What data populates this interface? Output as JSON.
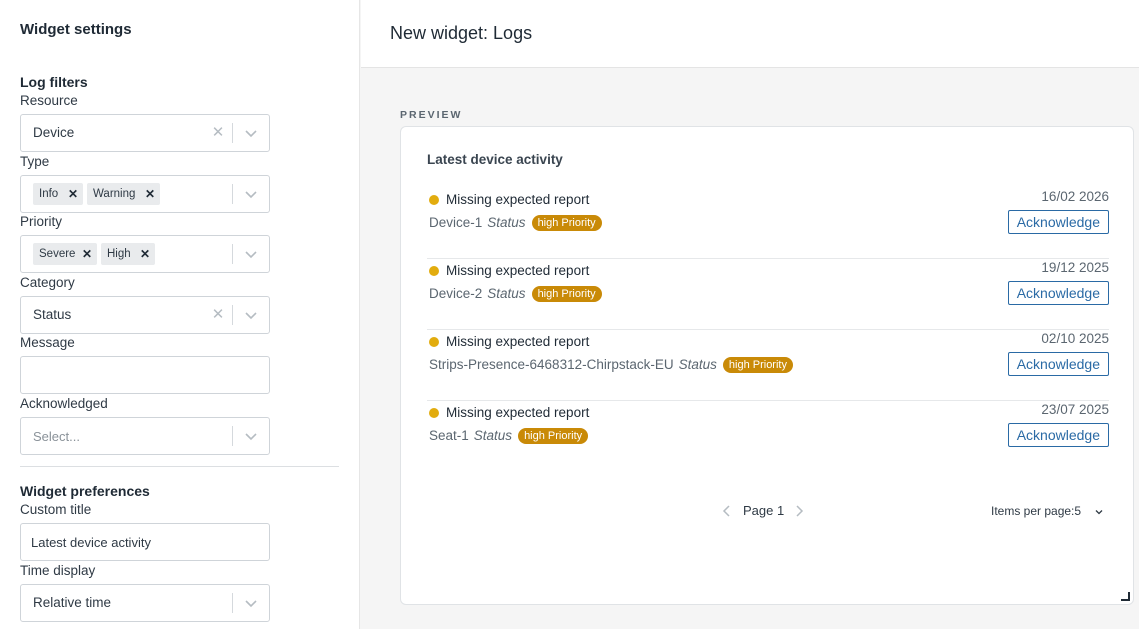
{
  "sidebar": {
    "title": "Widget settings",
    "log_filters": {
      "title": "Log filters",
      "resource": {
        "label": "Resource",
        "value": "Device"
      },
      "type": {
        "label": "Type",
        "chips": [
          "Info",
          "Warning"
        ]
      },
      "priority": {
        "label": "Priority",
        "chips": [
          "Severe",
          "High"
        ]
      },
      "category": {
        "label": "Category",
        "value": "Status"
      },
      "message": {
        "label": "Message",
        "value": ""
      },
      "acknowledged": {
        "label": "Acknowledged",
        "placeholder": "Select..."
      }
    },
    "widget_preferences": {
      "title": "Widget preferences",
      "custom_title": {
        "label": "Custom title",
        "value": "Latest device activity"
      },
      "time_display": {
        "label": "Time display",
        "value": "Relative time"
      }
    }
  },
  "header": {
    "title": "New widget: Logs"
  },
  "preview": {
    "label": "PREVIEW",
    "card_title": "Latest device activity",
    "rows": [
      {
        "message": "Missing expected report",
        "device": "Device-1",
        "category": "Status",
        "badge": "high Priority",
        "date": "16/02 2026",
        "action": "Acknowledge"
      },
      {
        "message": "Missing expected report",
        "device": "Device-2",
        "category": "Status",
        "badge": "high Priority",
        "date": "19/12 2025",
        "action": "Acknowledge"
      },
      {
        "message": "Missing expected report",
        "device": "Strips-Presence-6468312-Chirpstack-EU",
        "category": "Status",
        "badge": "high Priority",
        "date": "02/10 2025",
        "action": "Acknowledge"
      },
      {
        "message": "Missing expected report",
        "device": "Seat-1",
        "category": "Status",
        "badge": "high Priority",
        "date": "23/07 2025",
        "action": "Acknowledge"
      }
    ],
    "pagination": {
      "page_label": "Page 1",
      "items_per_page_label": "Items per page:",
      "items_per_page_value": "5"
    }
  },
  "colors": {
    "warning_dot": "#e2ac0e",
    "badge": "#c98a07",
    "link": "#2a6aa5"
  },
  "icons": [
    "clear-icon",
    "chevron-down-icon",
    "remove-chip-icon",
    "chevron-left-icon",
    "chevron-right-icon",
    "resize-handle-icon"
  ]
}
